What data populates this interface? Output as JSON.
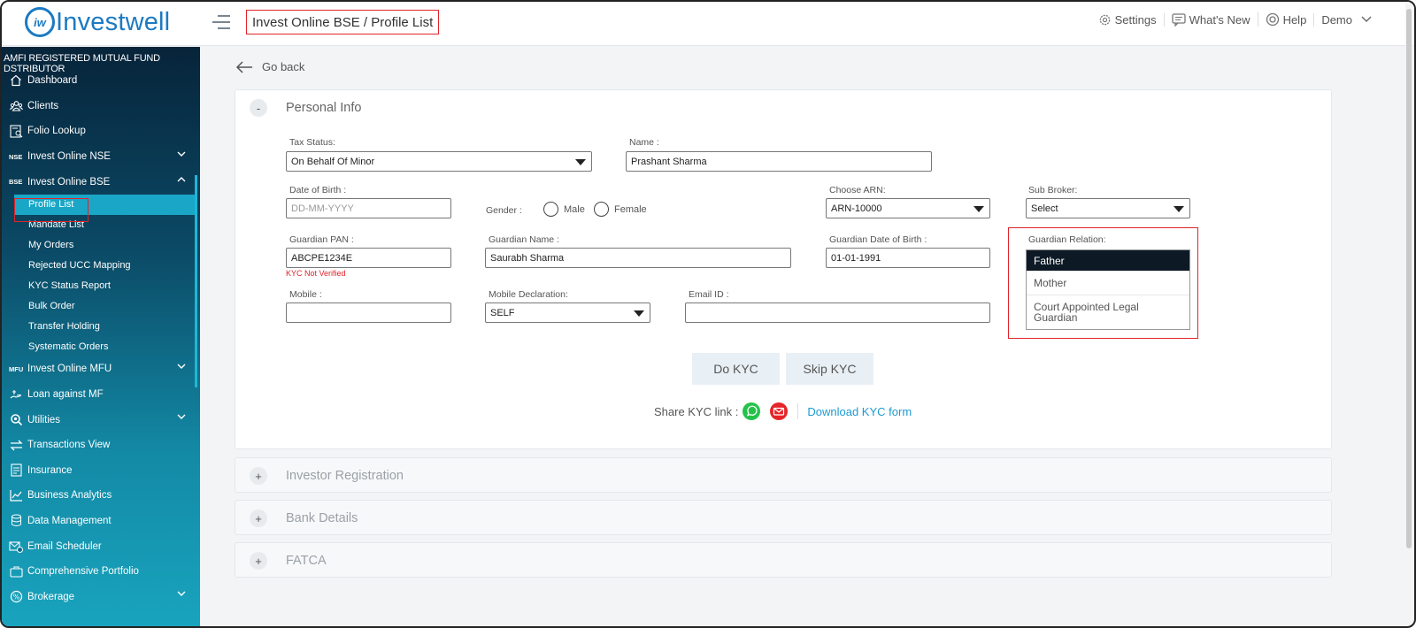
{
  "app": {
    "logo_text": "Investwell",
    "logo_mark": "iw"
  },
  "header": {
    "breadcrumb": "Invest Online BSE / Profile List",
    "settings": "Settings",
    "whats_new": "What's New",
    "help": "Help",
    "user": "Demo"
  },
  "sidebar": {
    "banner": "AMFI REGISTERED MUTUAL FUND DSTRIBUTOR",
    "items": [
      {
        "label": "Dashboard",
        "icon": "home-icon"
      },
      {
        "label": "Clients",
        "icon": "users-icon"
      },
      {
        "label": "Folio Lookup",
        "icon": "folio-icon"
      },
      {
        "label": "Invest Online NSE",
        "tag": "NSE"
      },
      {
        "label": "Invest Online BSE",
        "tag": "BSE"
      }
    ],
    "sub_items": [
      "Profile List",
      "Mandate List",
      "My Orders",
      "Rejected UCC Mapping",
      "KYC Status Report",
      "Bulk Order",
      "Transfer Holding",
      "Systematic Orders"
    ],
    "items2": [
      {
        "label": "Invest Online MFU",
        "tag": "MFU"
      },
      {
        "label": "Loan against MF",
        "icon": "loan-icon"
      },
      {
        "label": "Utilities",
        "icon": "utilities-icon"
      },
      {
        "label": "Transactions View",
        "icon": "transactions-icon"
      },
      {
        "label": "Insurance",
        "icon": "insurance-icon"
      },
      {
        "label": "Business Analytics",
        "icon": "analytics-icon"
      },
      {
        "label": "Data Management",
        "icon": "data-icon"
      },
      {
        "label": "Email Scheduler",
        "icon": "email-icon"
      },
      {
        "label": "Comprehensive Portfolio",
        "icon": "portfolio-icon"
      },
      {
        "label": "Brokerage",
        "icon": "brokerage-icon"
      }
    ]
  },
  "main": {
    "go_back": "Go back",
    "personal": {
      "toggle": "-",
      "title": "Personal Info",
      "tax_status_label": "Tax Status:",
      "tax_status_value": "On Behalf Of Minor",
      "name_label": "Name :",
      "name_value": "Prashant Sharma",
      "dob_label": "Date of Birth :",
      "dob_placeholder": "DD-MM-YYYY",
      "gender_label": "Gender :",
      "gender_male": "Male",
      "gender_female": "Female",
      "arn_label": "Choose ARN:",
      "arn_value": "ARN-10000",
      "sub_broker_label": "Sub Broker:",
      "sub_broker_value": "Select",
      "guardian_pan_label": "Guardian PAN :",
      "guardian_pan_value": "ABCPE1234E",
      "kyc_status": "KYC Not Verified",
      "guardian_name_label": "Guardian Name :",
      "guardian_name_value": "Saurabh Sharma",
      "guardian_dob_label": "Guardian Date of Birth :",
      "guardian_dob_value": "01-01-1991",
      "guardian_relation_label": "Guardian Relation:",
      "guardian_relation_options": [
        "Father",
        "Mother",
        "Court Appointed Legal Guardian"
      ],
      "mobile_label": "Mobile :",
      "mobile_value": "",
      "mobile_decl_label": "Mobile Declaration:",
      "mobile_decl_value": "SELF",
      "email_label": "Email ID :",
      "email_value": "",
      "do_kyc": "Do KYC",
      "skip_kyc": "Skip KYC",
      "share_label": "Share KYC link :",
      "download_link": "Download KYC form"
    },
    "sections": [
      {
        "toggle": "+",
        "title": "Investor Registration"
      },
      {
        "toggle": "+",
        "title": "Bank Details"
      },
      {
        "toggle": "+",
        "title": "FATCA"
      }
    ]
  },
  "colors": {
    "brand": "#1c7ac2",
    "highlight": "#e0232a",
    "sidebar_active": "#1aa7c7",
    "kyc_error": "#e0232a"
  }
}
